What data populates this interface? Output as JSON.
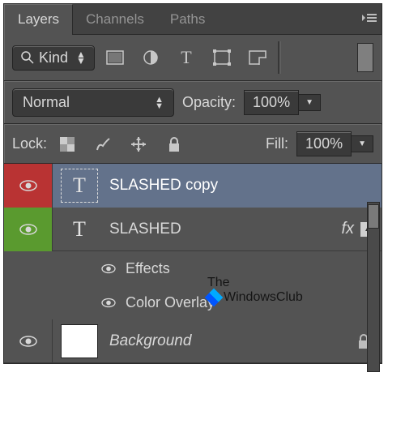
{
  "tabs": {
    "layers": "Layers",
    "channels": "Channels",
    "paths": "Paths"
  },
  "filter": {
    "kind": "Kind"
  },
  "blend": {
    "mode": "Normal",
    "opacity_label": "Opacity:",
    "opacity_value": "100%"
  },
  "lock": {
    "label": "Lock:",
    "fill_label": "Fill:",
    "fill_value": "100%"
  },
  "layers": [
    {
      "name": "SLASHED copy"
    },
    {
      "name": "SLASHED"
    },
    {
      "name": "Background"
    }
  ],
  "effects": {
    "header": "Effects",
    "item1": "Color Overlay",
    "fx": "fx"
  },
  "watermark": {
    "line1": "The",
    "line2": "WindowsClub"
  }
}
